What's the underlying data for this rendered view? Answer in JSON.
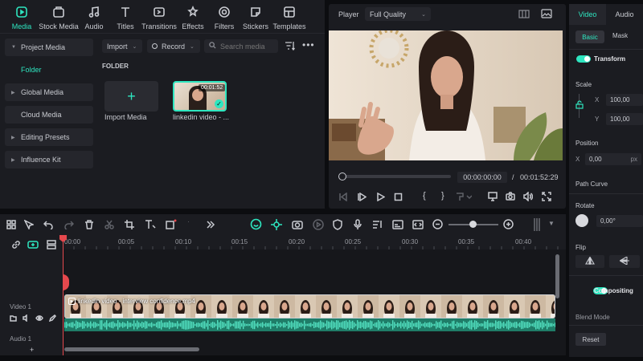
{
  "topbar": {
    "items": [
      {
        "label": "Media",
        "icon": "media-icon"
      },
      {
        "label": "Stock Media",
        "icon": "stock-media-icon"
      },
      {
        "label": "Audio",
        "icon": "music-note-icon"
      },
      {
        "label": "Titles",
        "icon": "titles-icon"
      },
      {
        "label": "Transitions",
        "icon": "transitions-icon"
      },
      {
        "label": "Effects",
        "icon": "effects-icon"
      },
      {
        "label": "Filters",
        "icon": "filters-icon"
      },
      {
        "label": "Stickers",
        "icon": "stickers-icon"
      },
      {
        "label": "Templates",
        "icon": "templates-icon"
      }
    ]
  },
  "sidebar": {
    "items": [
      {
        "label": "Project Media"
      },
      {
        "label": "Folder"
      },
      {
        "label": "Global Media"
      },
      {
        "label": "Cloud Media"
      },
      {
        "label": "Editing Presets"
      },
      {
        "label": "Influence Kit"
      }
    ]
  },
  "media": {
    "import_label": "Import",
    "record_label": "Record",
    "search_placeholder": "Search media",
    "folder_heading": "FOLDER",
    "import_media_label": "Import Media",
    "clip_label": "linkedin video - ...",
    "clip_duration": "00:01:52"
  },
  "player": {
    "label": "Player",
    "quality": "Full Quality",
    "current_time": "00:00:00:00",
    "separator": "/",
    "total_time": "00:01:52:29"
  },
  "props": {
    "tabs": [
      "Video",
      "Audio"
    ],
    "subtabs": [
      "Basic",
      "Mask"
    ],
    "transform_label": "Transform",
    "scale_label": "Scale",
    "scale_x_axis": "X",
    "scale_x": "100,00",
    "scale_y_axis": "Y",
    "scale_y": "100,00",
    "position_label": "Position",
    "position_x_axis": "X",
    "position_x": "0,00",
    "position_x_unit": "px",
    "path_curve_label": "Path Curve",
    "rotate_label": "Rotate",
    "rotate_value": "0,00°",
    "flip_label": "Flip",
    "compositing_label": "Compositing",
    "blend_mode_label": "Blend Mode",
    "reset_label": "Reset"
  },
  "timeline": {
    "ruler": [
      "00:00",
      "00:05",
      "00:10",
      "00:15",
      "00:20",
      "00:25",
      "00:30",
      "00:35",
      "00:40"
    ],
    "video_track_label": "Video 1",
    "audio_track_label": "Audio 1",
    "clip_title": "linkedin video - interview confidence.mp4"
  },
  "colors": {
    "accent": "#2ee6c0",
    "panel": "#1b1c21",
    "background": "#0c0d10",
    "playhead": "#e5484d"
  }
}
